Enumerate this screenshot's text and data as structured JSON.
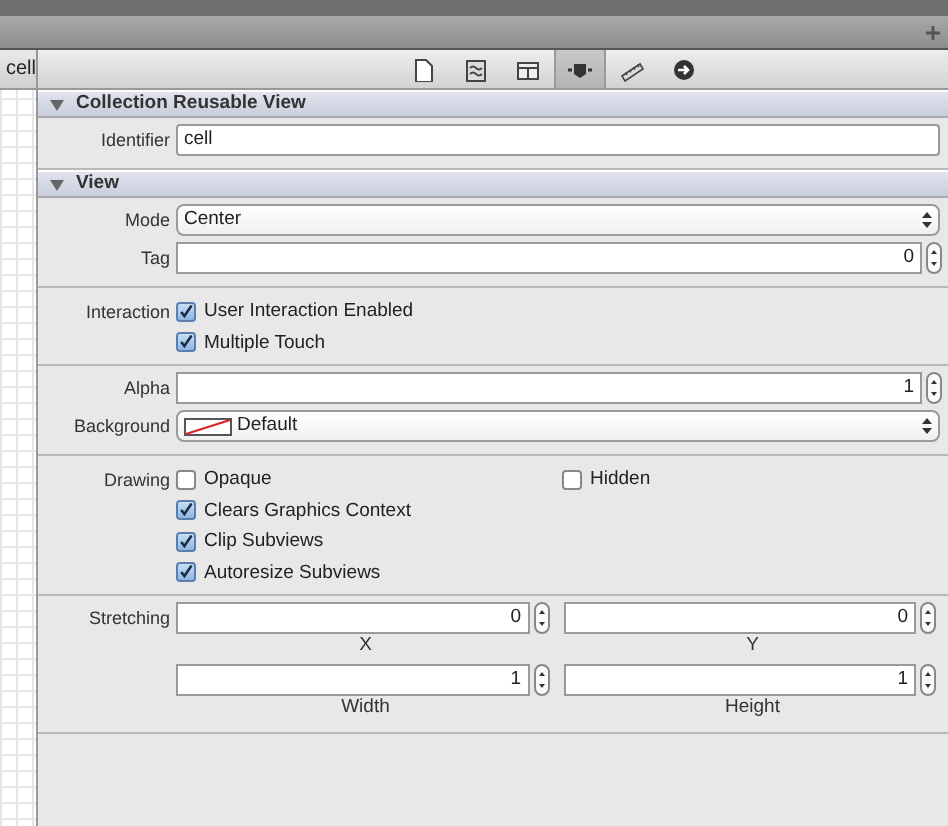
{
  "sidebar": {
    "label": "cell"
  },
  "toolbar": {
    "buttons": [
      {
        "kind": "file",
        "selected": false
      },
      {
        "kind": "help",
        "selected": false
      },
      {
        "kind": "identity",
        "selected": false
      },
      {
        "kind": "attributes",
        "selected": true
      },
      {
        "kind": "size",
        "selected": false
      },
      {
        "kind": "connections",
        "selected": false
      }
    ]
  },
  "sections": [
    {
      "title": "Collection Reusable View",
      "expanded": true,
      "groups": [
        {
          "rows": [
            {
              "kind": "text",
              "label": "Identifier",
              "value": "cell"
            }
          ]
        }
      ]
    },
    {
      "title": "View",
      "expanded": true,
      "groups": [
        {
          "rows": [
            {
              "kind": "popup",
              "label": "Mode",
              "value": "Center"
            },
            {
              "kind": "stepper",
              "label": "Tag",
              "value": "0"
            }
          ]
        },
        {
          "rows": [
            {
              "kind": "checks",
              "label": "Interaction",
              "lines": [
                [
                  {
                    "text": "User Interaction Enabled",
                    "checked": true
                  }
                ],
                [
                  {
                    "text": "Multiple Touch",
                    "checked": true
                  }
                ]
              ]
            }
          ]
        },
        {
          "rows": [
            {
              "kind": "stepper",
              "label": "Alpha",
              "value": "1"
            },
            {
              "kind": "color",
              "label": "Background",
              "value": "Default"
            }
          ]
        },
        {
          "rows": [
            {
              "kind": "checks",
              "label": "Drawing",
              "lines": [
                [
                  {
                    "text": "Opaque",
                    "checked": false
                  },
                  {
                    "text": "Hidden",
                    "checked": false
                  }
                ],
                [
                  {
                    "text": "Clears Graphics Context",
                    "checked": true
                  }
                ],
                [
                  {
                    "text": "Clip Subviews",
                    "checked": true
                  }
                ],
                [
                  {
                    "text": "Autoresize Subviews",
                    "checked": true
                  }
                ]
              ]
            }
          ]
        },
        {
          "rows": [
            {
              "kind": "pair",
              "label": "Stretching",
              "fields": [
                {
                  "value": "0",
                  "caption": "X"
                },
                {
                  "value": "0",
                  "caption": "Y"
                }
              ]
            },
            {
              "kind": "pair",
              "fields": [
                {
                  "value": "1",
                  "caption": "Width"
                },
                {
                  "value": "1",
                  "caption": "Height"
                }
              ]
            }
          ]
        }
      ]
    }
  ]
}
